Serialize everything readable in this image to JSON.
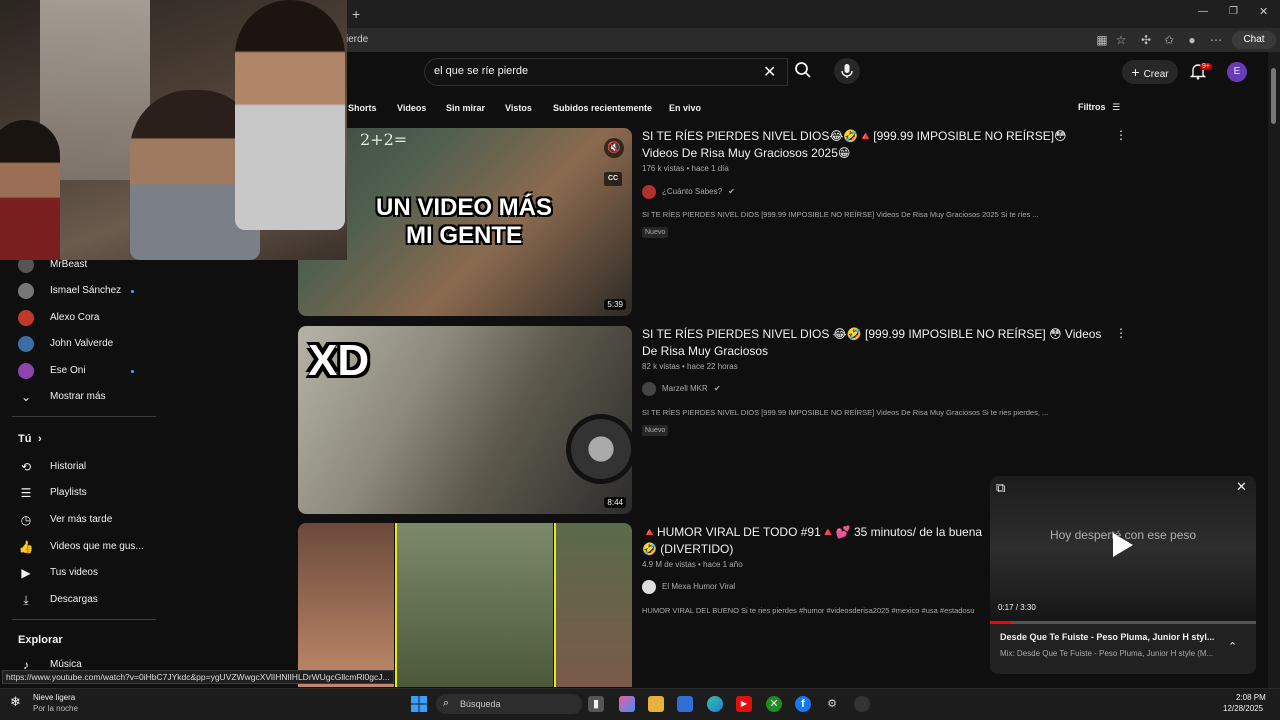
{
  "browser": {
    "url_fragment": "ierde",
    "chat_label": "Chat"
  },
  "header": {
    "search_value": "el que se ríe pierde",
    "create_label": "Crear",
    "notif_count": "9+",
    "avatar_letter": "E"
  },
  "chips": [
    "Shorts",
    "Videos",
    "Sin mirar",
    "Vistos",
    "Subidos recientemente",
    "En vivo"
  ],
  "filters_label": "Filtros",
  "sidebar": {
    "subscriptions": [
      {
        "label": "MrBeast",
        "dot": false
      },
      {
        "label": "Ismael Sánchez",
        "dot": true
      },
      {
        "label": "Alexo Cora",
        "dot": false
      },
      {
        "label": "John Valverde",
        "dot": false
      },
      {
        "label": "Ese Oni",
        "dot": true
      }
    ],
    "show_more": "Mostrar más",
    "you_heading": "Tú",
    "you_items": [
      "Historial",
      "Playlists",
      "Ver más tarde",
      "Videos que me gus...",
      "Tus videos",
      "Descargas"
    ],
    "explore_heading": "Explorar",
    "explore_items": [
      "Música"
    ]
  },
  "videos": [
    {
      "title": "SI TE RÍES PIERDES NIVEL DIOS😂🤣🔺[999.99 IMPOSIBLE NO REÍRSE]😳Videos De Risa Muy Graciosos 2025😁",
      "meta": "176 k vistas • hace 1 día",
      "channel": "¿Cuánto Sabes?",
      "verified": true,
      "description": "SI TE RÍES PIERDES NIVEL DIOS [999.99 IMPOSIBLE NO REÍRSE] Videos De Risa Muy Graciosos 2025 Si te ríes ...",
      "badge": "Nuevo",
      "duration": "5:39",
      "thumb_text": "UN VIDEO MÁS MI GENTE",
      "thumb_board": "2+2="
    },
    {
      "title": "SI TE RÍES PIERDES NIVEL DIOS 😂🤣 [999.99 IMPOSIBLE NO REÍRSE] 😳 Videos De Risa Muy Graciosos",
      "meta": "82 k vistas • hace 22 horas",
      "channel": "Marzell MKR",
      "verified": true,
      "description": "SI TE RÍES PIERDES NIVEL DIOS [999.99 IMPOSIBLE NO REÍRSE] Videos De Risa Muy Graciosos Si te ries pierdes, ...",
      "badge": "Nuevo",
      "duration": "8:44",
      "thumb_text": "XD"
    },
    {
      "title": "🔺HUMOR VIRAL DE TODO #91🔺💕 35 minutos/ de la buena🤣 (DIVERTIDO)",
      "meta": "4.9 M de vistas • hace 1 año",
      "channel": "El Mexa Humor Viral",
      "verified": false,
      "description": "HUMOR VIRAL DEL BUENO Si te ries pierdes #humor #videosderisa2025 #mexico #usa #estadosu",
      "badge": "",
      "duration": ""
    }
  ],
  "miniplayer": {
    "overlay_text": "Hoy desperté con ese peso",
    "time": "0:17 / 3:30",
    "progress": 0.08,
    "title": "Desde Que Te Fuiste - Peso Pluma, Junior H styl...",
    "subtitle": "Mix: Desde Que Te Fuiste - Peso Pluma, Junior H style (M..."
  },
  "status_url": "https://www.youtube.com/watch?v=0iHbC7JYkdc&pp=ygUVZWwgcXVlIHNlIHLDrWUgcGllcmRl0gcJ...",
  "taskbar": {
    "weather_title": "Nieve ligera",
    "weather_sub": "Por la noche",
    "search_placeholder": "Búsqueda",
    "time": "2:08 PM",
    "date": "12/28/2025"
  },
  "colors": {
    "accent_red": "#ff0000",
    "link_blue": "#3ea6ff",
    "bg": "#0f0f0f"
  }
}
